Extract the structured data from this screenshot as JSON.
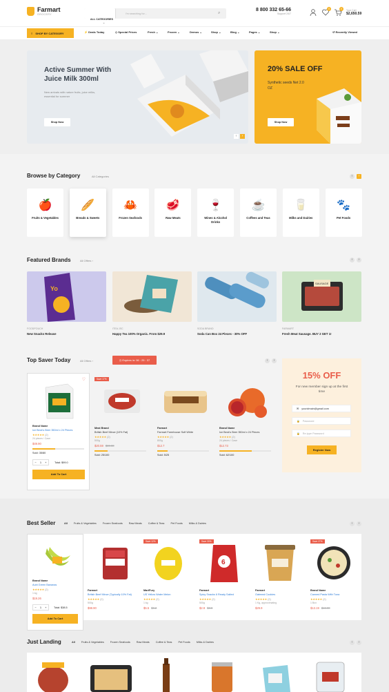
{
  "header": {
    "logo_title": "Farmart",
    "logo_sub": "GROCERY",
    "search_category": "ALL CATEGORIES",
    "search_placeholder": "I'm searching for...",
    "phone": "8 800 332 65-66",
    "phone_sub": "Support 24/7",
    "wishlist_count": "0",
    "cart_count": "0",
    "cart_label": "Your Cart",
    "cart_total": "$2,650.59"
  },
  "nav": {
    "shop_by_category": "SHOP BY CATEGORY",
    "items": [
      "Deals Today",
      "Special Prices",
      "Fresh",
      "Frozen",
      "Demos",
      "Shop",
      "Blog",
      "Pages",
      "Shop"
    ],
    "recently_viewed": "Recently Viewed"
  },
  "hero": {
    "banner1_title": "Active Summer With Juice Milk 300ml",
    "banner1_text": "New arrivals with nature  fruits, juice milks, essential for summer",
    "banner1_button": "Shop Now",
    "banner2_title": "20% SALE OFF",
    "banner2_text": "Synthetic seeds Net 2.0 OZ",
    "banner2_button": "Shop Now"
  },
  "categories": {
    "title": "Browse by Category",
    "link": "All Categories",
    "items": [
      {
        "label": "Fruits & Vegetables",
        "icon": "fruits-icon"
      },
      {
        "label": "Breads & Sweets",
        "icon": "bread-icon"
      },
      {
        "label": "Frozen Seafoods",
        "icon": "crab-icon"
      },
      {
        "label": "Raw Meats",
        "icon": "meat-icon"
      },
      {
        "label": "Wines & Alcohol Drinks",
        "icon": "wine-icon"
      },
      {
        "label": "Coffees and Teas",
        "icon": "coffee-icon"
      },
      {
        "label": "Milks and Dairies",
        "icon": "milk-icon"
      },
      {
        "label": "Pet Foods",
        "icon": "pet-food-icon"
      }
    ]
  },
  "brands": {
    "title": "Featured Brands",
    "link": "All Offers",
    "items": [
      {
        "brand": "FOODPOUCH",
        "title": "New Snacks Release"
      },
      {
        "brand": "ITEA JSC",
        "title": "Happy Tea 100% Organic. From $29.9"
      },
      {
        "brand": "SODA BRAND",
        "title": "Soda Can Box 24 Pieces - 30% OFF"
      },
      {
        "brand": "FARMART",
        "title": "Fresh Meat Sausage. BUY 2 GET 1!"
      }
    ]
  },
  "topsaver": {
    "title": "Top Saver Today",
    "link": "All Offers",
    "timer_label": "Expires in:",
    "timer": "06 : 25 : 37",
    "featured": {
      "vendor": "Brand Name",
      "name": "Ice Beck's Beer 350ml x 24 Pieces",
      "reviews": "(2)",
      "size": "24 pieces / Case",
      "price": "$49.90",
      "sold": "Sold: 35/80",
      "sold_pct": 0.44,
      "qty": "1",
      "total": "Total: $99.0",
      "button": "Add To Cart"
    },
    "products": [
      {
        "tag": "Save 17%",
        "vendor": "Meat Brand",
        "name": "British Beef Mince (10% Fat)",
        "reviews": "(2)",
        "size": "500g",
        "price": "$20.59",
        "old": "$30.00",
        "sold": "Sold: 25/100",
        "sold_pct": 0.25
      },
      {
        "tag": "",
        "vendor": "Farmart",
        "name": "Farmart Farmhouse Soft White",
        "reviews": "(2)",
        "size": "800g",
        "price": "$12.7",
        "old": "",
        "sold": "Sold: 5/25",
        "sold_pct": 0.2
      },
      {
        "tag": "",
        "vendor": "Brand Name",
        "name": "Ice Beck's Beer 350ml x 24 Pieces",
        "reviews": "(2)",
        "size": "24 pieces / Case",
        "price": "$12.73",
        "old": "",
        "sold": "Sold: 62/100",
        "sold_pct": 0.62
      }
    ],
    "signup": {
      "title": "15% OFF",
      "text": "For new member sign up at the first time",
      "email": "youridmain@gmail.com",
      "password": "Password",
      "repassword": "Re-type Password",
      "button": "Register Now"
    }
  },
  "bestseller": {
    "title": "Best Seller",
    "tabs": [
      "All",
      "Fruits & Vegetables",
      "Frozen Seafoods",
      "Raw Meats",
      "Coffee & Teas",
      "Pet Foods",
      "Milks & Dairies"
    ],
    "featured": {
      "vendor": "Brand Name",
      "name": "Aubi Green Bananas",
      "reviews": "(2)",
      "size": "1 kg",
      "price": "$19.26",
      "qty": "1",
      "total": "Total: $38.5",
      "button": "Add To Cart"
    },
    "products": [
      {
        "tag": "",
        "vendor": "Farmart",
        "name": "British Beef Mince (Typically 10% Fat)",
        "reviews": "(2)",
        "size": "500g",
        "price": "$98.90",
        "old": ""
      },
      {
        "tag": "Save 12%",
        "vendor": "MartFury",
        "name": "US Yellow Water Melon",
        "reviews": "(2)",
        "size": "1 kg",
        "price": "$5.5",
        "old": "$6.2"
      },
      {
        "tag": "Save 30%",
        "vendor": "Farmart",
        "name": "Spicy Snacks 6 Ready Salted",
        "reviews": "(2)",
        "size": "500g",
        "price": "$2.9",
        "old": "$3.8"
      },
      {
        "tag": "",
        "vendor": "Farmart",
        "name": "Oatmeal Cookies",
        "reviews": "(2)",
        "size": "1 Kg, approximating",
        "price": "$29.9",
        "old": ""
      },
      {
        "tag": "Save 27%",
        "vendor": "Brand Name",
        "name": "Canned Pasta With Tuna",
        "reviews": "(2)",
        "size": "1 Box",
        "price": "$13.19",
        "old": "$18.00"
      }
    ]
  },
  "justlanding": {
    "title": "Just Landing",
    "tabs": [
      "All",
      "Fruits & Vegetables",
      "Frozen Seafoods",
      "Raw Meats",
      "Coffee & Teas",
      "Pet Foods",
      "Milks & Dairies"
    ]
  },
  "colors": {
    "accent": "#f6b223",
    "sale": "#e95d4a",
    "link": "#2a7ad6"
  }
}
